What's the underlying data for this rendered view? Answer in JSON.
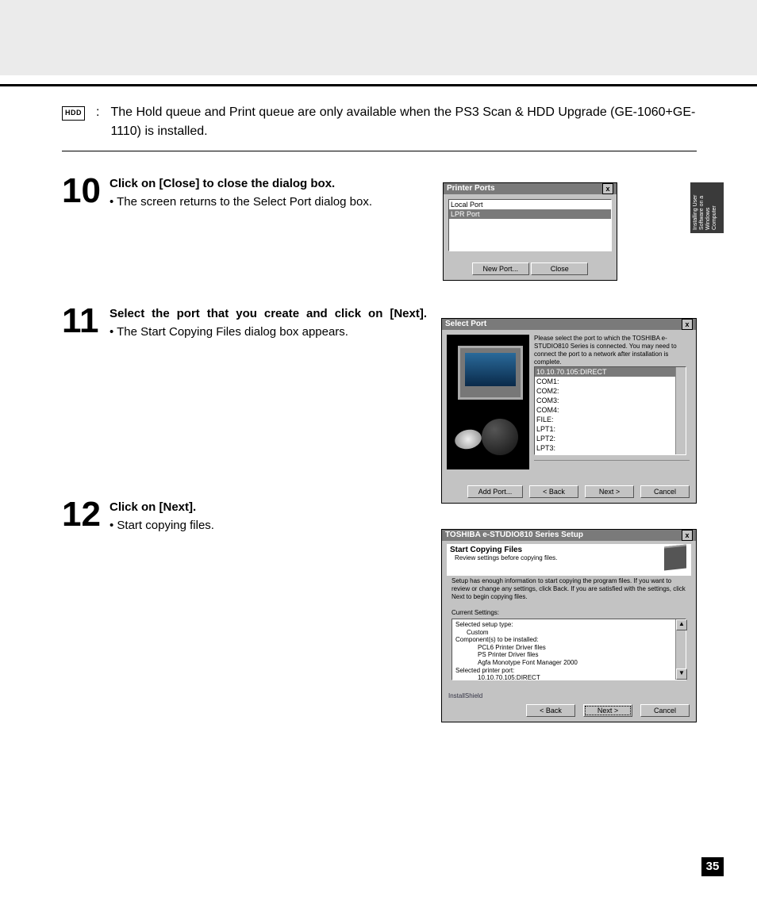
{
  "sidetab": "Installing User Software on a Windows Computer",
  "page_number": "35",
  "note": {
    "icon": "HDD",
    "colon": ":",
    "text": "The Hold queue and Print queue are only available when the PS3 Scan & HDD Upgrade (GE-1060+GE-1110) is installed."
  },
  "steps": {
    "s10": {
      "num": "10",
      "title": "Click on [Close] to close the dialog box.",
      "bullet": "• The screen returns to the Select Port dialog box."
    },
    "s11": {
      "num": "11",
      "title": "Select the port that you create and click on [Next].",
      "bullet": "• The Start Copying Files dialog box appears."
    },
    "s12": {
      "num": "12",
      "title": "Click on [Next].",
      "bullet": "• Start copying files."
    }
  },
  "dlg10": {
    "title": "Printer Ports",
    "close_x": "x",
    "items": {
      "i0": "Local Port",
      "i1": "LPR Port"
    },
    "new_port": "New Port...",
    "close_btn": "Close"
  },
  "dlg11": {
    "title": "Select Port",
    "close_x": "x",
    "instr": "Please select the port to which the TOSHIBA e-STUDIO810 Series is connected. You may need to connect the port to a network after installation is complete.",
    "items": {
      "i0": "10.10.70.105:DIRECT",
      "i1": "COM1:",
      "i2": "COM2:",
      "i3": "COM3:",
      "i4": "COM4:",
      "i5": "FILE:",
      "i6": "LPT1:",
      "i7": "LPT2:",
      "i8": "LPT3:"
    },
    "add_port": "Add Port...",
    "back": "< Back",
    "next": "Next >",
    "cancel": "Cancel"
  },
  "dlg12": {
    "title": "TOSHIBA e-STUDIO810 Series Setup",
    "close_x": "x",
    "hdr_title": "Start Copying Files",
    "hdr_sub": "Review settings before copying files.",
    "note_text": "Setup has enough information to start copying the program files. If you want to review or change any settings, click Back. If you are satisfied with the settings, click Next to begin copying files.",
    "cs_label": "Current Settings:",
    "settings": {
      "l0": "Selected setup type:",
      "l1": "Custom",
      "l2": "Component(s) to be installed:",
      "l3": "PCL6 Printer Driver files",
      "l4": "PS Printer Driver files",
      "l5": "Agfa Monotype Font Manager 2000",
      "l6": "Selected printer port:",
      "l7": "10.10.70.105:DIRECT"
    },
    "ishield": "InstallShield",
    "back": "< Back",
    "next": "Next >",
    "cancel": "Cancel"
  }
}
